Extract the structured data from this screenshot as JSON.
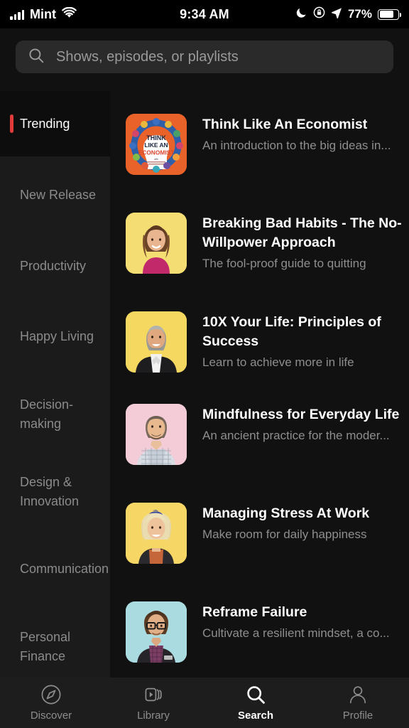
{
  "status_bar": {
    "carrier": "Mint",
    "signal_icon": "cellular-bars-icon",
    "wifi_icon": "wifi-icon",
    "time": "9:34 AM",
    "dnd_icon": "moon-icon",
    "rotation_lock_icon": "rotation-lock-icon",
    "location_icon": "location-arrow-icon",
    "battery_percent": "77%",
    "battery_icon": "battery-icon"
  },
  "search": {
    "icon": "search-icon",
    "placeholder": "Shows, episodes, or playlists",
    "value": ""
  },
  "sidebar": {
    "items": [
      {
        "label": "Trending",
        "active": true
      },
      {
        "label": "New Release",
        "active": false
      },
      {
        "label": "Productivity",
        "active": false
      },
      {
        "label": "Happy Living",
        "active": false
      },
      {
        "label": "Decision-making",
        "active": false
      },
      {
        "label": "Design & Innovation",
        "active": false
      },
      {
        "label": "Communication",
        "active": false
      },
      {
        "label": "Personal Finance",
        "active": false
      }
    ]
  },
  "list": {
    "items": [
      {
        "title": "Think Like An Economist",
        "subtitle": "An introduction to the big ideas in...",
        "thumb_kind": "economist-cover",
        "thumb_bg": "#e8622a",
        "thumb_name": "thumbnail-think-like-an-economist"
      },
      {
        "title": "Breaking Bad Habits - The No-Willpower Approach",
        "subtitle": "The fool-proof guide to quitting",
        "thumb_kind": "portrait-woman-pink",
        "thumb_bg": "#f4dd73",
        "thumb_name": "thumbnail-breaking-bad-habits"
      },
      {
        "title": "10X Your Life: Principles of Success",
        "subtitle": "Learn to achieve more in life",
        "thumb_kind": "portrait-man-suit",
        "thumb_bg": "#f5d860",
        "thumb_name": "thumbnail-10x-your-life"
      },
      {
        "title": "Mindfulness for Everyday Life",
        "subtitle": "An ancient practice for the moder...",
        "thumb_kind": "portrait-man-plaid",
        "thumb_bg": "#f4ccd8",
        "thumb_name": "thumbnail-mindfulness-for-everyday-life"
      },
      {
        "title": "Managing Stress At Work",
        "subtitle": "Make room for daily happiness",
        "thumb_kind": "portrait-woman-blonde",
        "thumb_bg": "#f6d765",
        "thumb_name": "thumbnail-managing-stress-at-work"
      },
      {
        "title": "Reframe Failure",
        "subtitle": "Cultivate a resilient mindset, a co...",
        "thumb_kind": "portrait-man-glasses",
        "thumb_bg": "#a9dbe0",
        "thumb_name": "thumbnail-reframe-failure"
      }
    ]
  },
  "cover_art": {
    "economist": {
      "line1": "THINK",
      "line2": "LIKE AN",
      "line3": "ECONOMIST",
      "byline": "with"
    }
  },
  "bottom_nav": {
    "items": [
      {
        "label": "Discover",
        "icon": "compass-icon",
        "active": false
      },
      {
        "label": "Library",
        "icon": "library-cards-icon",
        "active": false
      },
      {
        "label": "Search",
        "icon": "search-icon",
        "active": true
      },
      {
        "label": "Profile",
        "icon": "person-icon",
        "active": false
      }
    ]
  },
  "theme": {
    "background": "#111111",
    "sidebar_background": "#1b1b1b",
    "active_accent": "#e03a3a",
    "nav_background": "#1d1d1d",
    "text_primary": "#ffffff",
    "text_secondary": "#8e8e8e"
  }
}
